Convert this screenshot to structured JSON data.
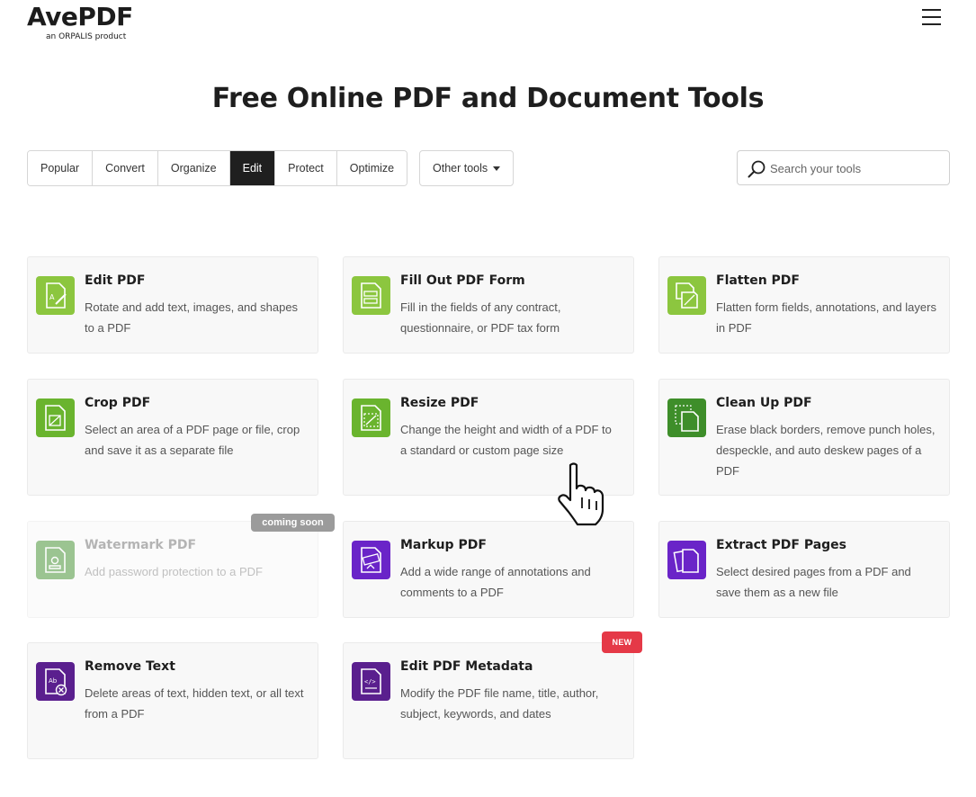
{
  "header": {
    "logo": "AvePDF",
    "logo_sub": "an ORPALIS product"
  },
  "page_title": "Free Online PDF and Document Tools",
  "tabs": [
    {
      "label": "Popular",
      "active": false
    },
    {
      "label": "Convert",
      "active": false
    },
    {
      "label": "Organize",
      "active": false
    },
    {
      "label": "Edit",
      "active": true
    },
    {
      "label": "Protect",
      "active": false
    },
    {
      "label": "Optimize",
      "active": false
    }
  ],
  "other_tools": {
    "label": "Other tools"
  },
  "search": {
    "placeholder": "Search your tools"
  },
  "colors": {
    "green_light": "#8cc63f",
    "green": "#6ab42e",
    "green_dark": "#3e8e2a",
    "purple": "#6a24c8",
    "purple_dark": "#5a1f8e",
    "badge_new": "#e53947",
    "badge_soon": "#9b9b9b"
  },
  "badges": {
    "coming_soon": "coming soon",
    "new": "NEW"
  },
  "cards": [
    {
      "title": "Edit PDF",
      "desc": "Rotate and add text, images, and shapes to a PDF",
      "icon": "edit-pdf-icon"
    },
    {
      "title": "Fill Out PDF Form",
      "desc": "Fill in the fields of any contract, questionnaire, or PDF tax form",
      "icon": "form-icon"
    },
    {
      "title": "Flatten PDF",
      "desc": "Flatten form fields, annotations, and layers in PDF",
      "icon": "flatten-icon"
    },
    {
      "title": "Crop PDF",
      "desc": "Select an area of a PDF page or file, crop and save it as a separate file",
      "icon": "crop-icon"
    },
    {
      "title": "Resize PDF",
      "desc": "Change the height and width of a PDF to a standard or custom page size",
      "icon": "resize-icon"
    },
    {
      "title": "Clean Up PDF",
      "desc": "Erase black borders, remove punch holes, despeckle, and auto deskew pages of a PDF",
      "icon": "cleanup-icon"
    },
    {
      "title": "Watermark PDF",
      "desc": "Add password protection to a PDF",
      "icon": "watermark-icon"
    },
    {
      "title": "Markup PDF",
      "desc": "Add a wide range of annotations and comments to a PDF",
      "icon": "markup-icon"
    },
    {
      "title": "Extract PDF Pages",
      "desc": "Select desired pages from a PDF and save them as a new file",
      "icon": "extract-pages-icon"
    },
    {
      "title": "Remove Text",
      "desc": "Delete areas of text, hidden text, or all text from a PDF",
      "icon": "remove-text-icon"
    },
    {
      "title": "Edit PDF Metadata",
      "desc": "Modify the PDF file name, title, author, subject, keywords, and dates",
      "icon": "metadata-icon"
    }
  ]
}
